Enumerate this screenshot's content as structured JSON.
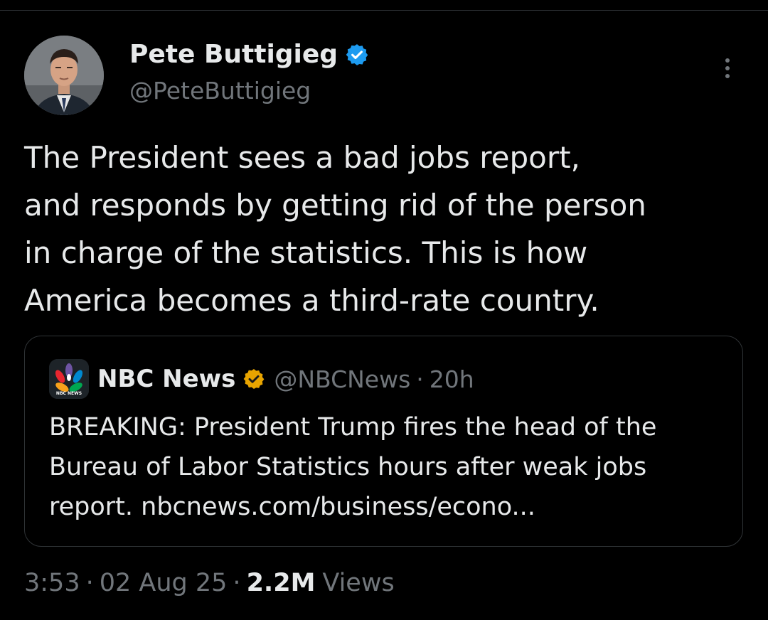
{
  "author": {
    "name": "Pete Buttigieg",
    "handle": "@PeteButtigieg",
    "verified_color": "#1d9bf0"
  },
  "tweet": {
    "lines": [
      "The President sees a bad jobs report,",
      "and responds by getting rid of the person",
      "in charge of the statistics. This is how",
      "America becomes a third-rate country."
    ]
  },
  "quote": {
    "logo_text": "NBC NEWS",
    "name": "NBC News",
    "handle": "@NBCNews",
    "separator": "·",
    "time": "20h",
    "verified_color": "#e8a400",
    "lines": [
      "BREAKING: President Trump fires the head of the",
      "Bureau of Labor Statistics hours after weak jobs",
      "report. nbcnews.com/business/econo..."
    ]
  },
  "meta": {
    "time": "3:53",
    "separator": "·",
    "date": "02 Aug 25",
    "views_count": "2.2M",
    "views_label": "Views"
  },
  "icons": {
    "more": "more-options-icon",
    "verified": "verified-badge-icon",
    "gold_verified": "gold-verified-badge-icon"
  }
}
